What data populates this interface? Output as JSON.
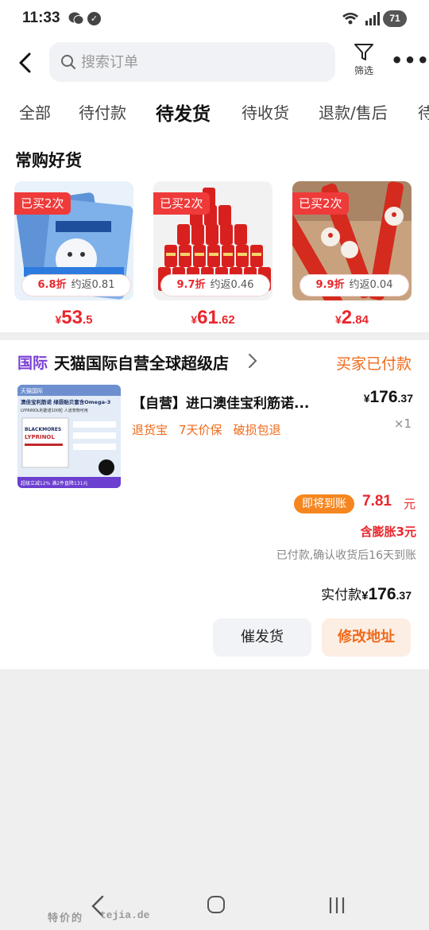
{
  "status_bar": {
    "time": "11:33",
    "battery": "71",
    "network_label": "6"
  },
  "header": {
    "search_placeholder": "搜索订单",
    "filter_label": "筛选"
  },
  "tabs": [
    {
      "label": "全部",
      "active": false
    },
    {
      "label": "待付款",
      "active": false
    },
    {
      "label": "待发货",
      "active": true
    },
    {
      "label": "待收货",
      "active": false
    },
    {
      "label": "退款/售后",
      "active": false
    },
    {
      "label": "待",
      "active": false
    }
  ],
  "favorites": {
    "title": "常购好货",
    "items": [
      {
        "badge": "已买2次",
        "discount": "6.8折",
        "rebate": "约返0.81",
        "price_symbol": "¥",
        "price_int": "53",
        "price_dec": ".5"
      },
      {
        "badge": "已买2次",
        "discount": "9.7折",
        "rebate": "约返0.46",
        "price_symbol": "¥",
        "price_int": "61",
        "price_dec": ".62"
      },
      {
        "badge": "已买2次",
        "discount": "9.9折",
        "rebate": "约返0.04",
        "price_symbol": "¥",
        "price_int": "2",
        "price_dec": ".84"
      }
    ]
  },
  "order": {
    "store_tag": "国际",
    "store_name": "天猫国际自营全球超级店",
    "status": "买家已付款",
    "product_name": "【自营】进口澳佳宝利筋诺...",
    "price_symbol": "¥",
    "price_int": "176",
    "price_dec": ".37",
    "quantity": "×1",
    "services": [
      "退货宝",
      "7天价保",
      "破损包退"
    ],
    "arrive_badge": "即将到账",
    "arrive_amount": "7.81",
    "arrive_unit": "元",
    "swell_note": "含膨胀3元",
    "settle_note": "已付款,确认收货后16天到账",
    "paid_label": "实付款",
    "paid_symbol": "¥",
    "paid_int": "176",
    "paid_dec": ".37",
    "btn_urge": "催发货",
    "btn_address": "修改地址",
    "image_text": {
      "top_tag": "天猫国际",
      "headline": "澳佳宝利筋诺 绿唇贻贝富含Omega-3",
      "sub": "LYPRINOL利筋诺100粒 人道宠物可用",
      "brand": "BLACKMORES",
      "product": "LYPRINOL",
      "bottom": "超级立减12%  满2件直降131元"
    }
  },
  "watermark": {
    "cn": "特价的",
    "url": "tejia.de"
  },
  "colors": {
    "accent_red": "#e8262c",
    "accent_orange": "#f06a1a",
    "intl_purple": "#7b3fd6"
  }
}
